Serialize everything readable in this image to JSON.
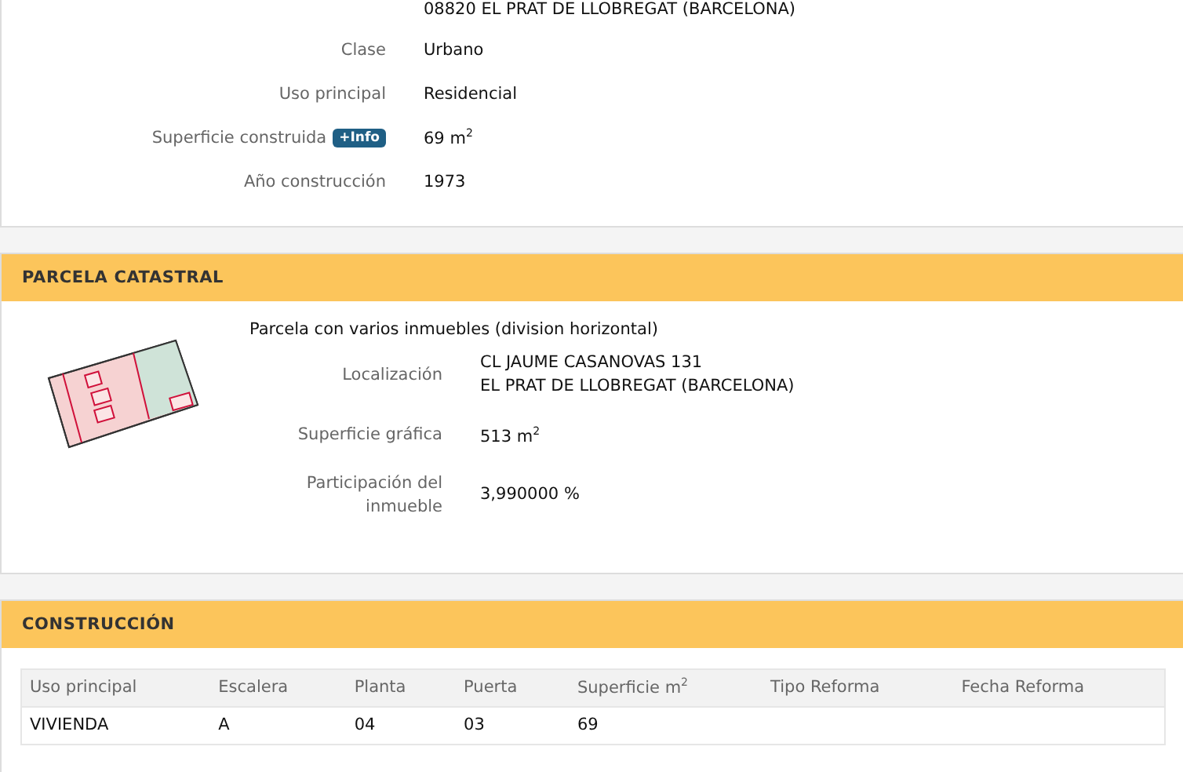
{
  "inmueble": {
    "address_continuation": "08820 EL PRAT DE LLOBREGAT (BARCELONA)",
    "fields": [
      {
        "label": "Clase",
        "value": "Urbano"
      },
      {
        "label": "Uso principal",
        "value": "Residencial"
      },
      {
        "label": "Superficie construida",
        "badge": "+Info",
        "value": "69 m$^{2}$"
      },
      {
        "label": "Año construcción",
        "value": "1973"
      }
    ]
  },
  "parcela": {
    "title": "PARCELA CATASTRAL",
    "description": "Parcela con varios inmuebles (division horizontal)",
    "fields": [
      {
        "label": "Localización",
        "lines": [
          "CL JAUME CASANOVAS 131",
          "EL PRAT DE LLOBREGAT (BARCELONA)"
        ]
      },
      {
        "label": "Superficie gráfica",
        "lines": [
          "513 m$^{2}$"
        ]
      },
      {
        "label": "Participación del inmueble",
        "lines": [
          "3,990000 %"
        ]
      }
    ]
  },
  "construccion": {
    "title": "CONSTRUCCIÓN",
    "columns": [
      "Uso principal",
      "Escalera",
      "Planta",
      "Puerta",
      "Superficie m$^{2}$",
      "Tipo Reforma",
      "Fecha Reforma"
    ],
    "rows": [
      [
        "VIVIENDA",
        "A",
        "04",
        "03",
        "69",
        "",
        ""
      ]
    ]
  }
}
